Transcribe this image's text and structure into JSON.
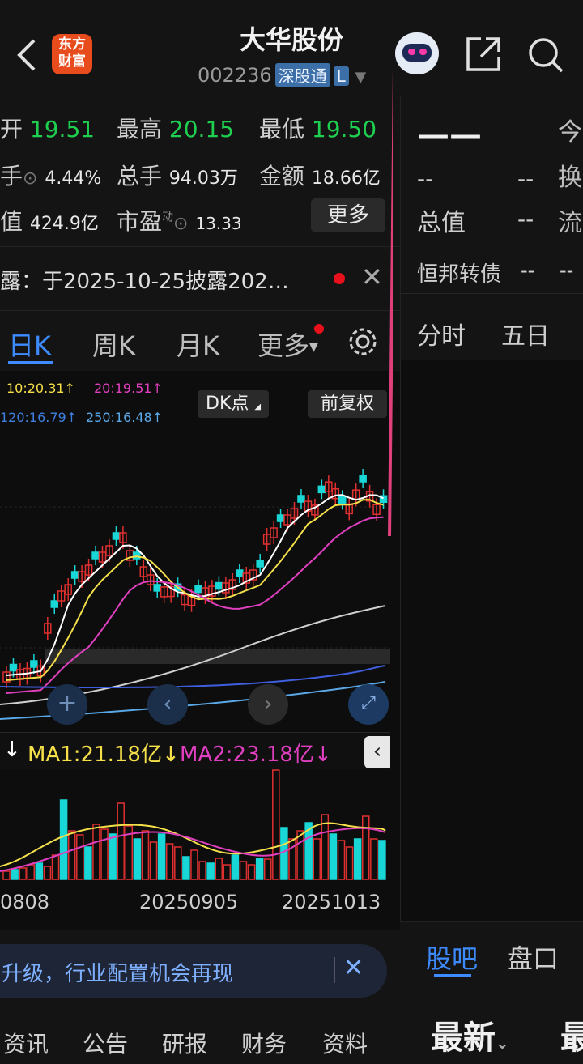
{
  "header": {
    "logo_text": "东方财富",
    "title": "大华股份",
    "code": "002236",
    "tag1": "深股通",
    "tag2": "L"
  },
  "quote": {
    "open_label": "开",
    "open": "19.51",
    "high_label": "最高",
    "high": "20.15",
    "low_label": "最低",
    "low": "19.50",
    "turnover_label": "手",
    "turnover": "4.44%",
    "volume_label": "总手",
    "volume": "94.03万",
    "amount_label": "金额",
    "amount": "18.66亿",
    "mcap_label": "值",
    "mcap": "424.9亿",
    "pe_label": "市盈",
    "pe_sup": "动",
    "pe": "13.33",
    "more": "更多"
  },
  "notice": {
    "text": "露：于2025-10-25披露202…"
  },
  "ktabs": [
    "日K",
    "周K",
    "月K",
    "更多"
  ],
  "ma_lines": {
    "ma10": "10:20.31↑",
    "ma20": "20:19.51↑",
    "ma120": "120:16.79↑",
    "ma250": "250:16.48↑",
    "dk": "DK点",
    "fq": "前复权"
  },
  "vol_header": {
    "ma1": "MA1:21.18亿",
    "ma2": "MA2:23.18亿"
  },
  "dates": [
    "0808",
    "20250905",
    "20251013"
  ],
  "banner": {
    "text": "升级，行业配置机会再现"
  },
  "bottom_tabs": [
    "资讯",
    "公告",
    "研报",
    "财务",
    "资料"
  ],
  "right": {
    "price": "——",
    "today": "今",
    "dash": "--",
    "huan": "换",
    "total_label": "总值",
    "liu": "流",
    "hb_label": "恒邦转债",
    "tab_fs": "分时",
    "tab_5d": "五日",
    "guba": "股吧",
    "pankou": "盘口",
    "latest": "最新",
    "latest2": "最"
  },
  "colors": {
    "up": "#e03030",
    "down": "#19d7d7",
    "accent": "#3d8bff",
    "ma5": "#ffffff",
    "ma10": "#f5e04a",
    "ma20": "#e040c0",
    "ma60": "#cfcfcf",
    "ma120": "#3f5fe0",
    "ma250": "#5aa8e8"
  }
}
